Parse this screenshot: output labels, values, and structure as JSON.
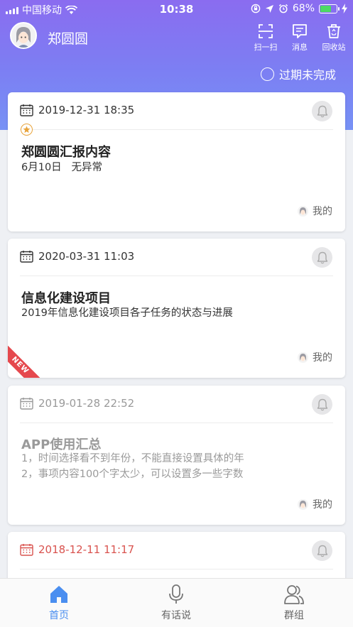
{
  "status_bar": {
    "carrier": "中国移动",
    "time": "10:38",
    "battery_percent": "68%",
    "battery_level": 0.68
  },
  "header": {
    "user_name": "郑圆圆",
    "actions": [
      {
        "label": "扫一扫",
        "icon": "scan-icon"
      },
      {
        "label": "消息",
        "icon": "message-icon"
      },
      {
        "label": "回收站",
        "icon": "recycle-bin-icon"
      }
    ],
    "filter_label": "过期未完成"
  },
  "cards": [
    {
      "datetime": "2019-12-31 18:35",
      "title": "郑圆圆汇报内容",
      "desc": [
        "6月10日   无异常"
      ],
      "owner": "我的",
      "starred": true,
      "state": "normal"
    },
    {
      "datetime": "2020-03-31 11:03",
      "title": "信息化建设项目",
      "desc": [
        "2019年信息化建设项目各子任务的状态与进展"
      ],
      "owner": "我的",
      "badge": "NEW",
      "state": "normal"
    },
    {
      "datetime": "2019-01-28 22:52",
      "title": "APP使用汇总",
      "desc": [
        "1，时间选择看不到年份，不能直接设置具体的年",
        "2，事项内容100个字太少，可以设置多一些字数"
      ],
      "owner": "我的",
      "state": "completed"
    },
    {
      "datetime": "2018-12-11 11:17",
      "state": "overdue"
    }
  ],
  "tabs": [
    {
      "label": "首页",
      "icon": "home-icon",
      "active": true
    },
    {
      "label": "有话说",
      "icon": "microphone-icon",
      "active": false
    },
    {
      "label": "群组",
      "icon": "group-icon",
      "active": false
    }
  ],
  "colors": {
    "header_gradient_top": "#8a6cf0",
    "header_gradient_bottom": "#7792f5",
    "active_tab": "#4a8ef0",
    "overdue": "#d9534f",
    "new_badge": "#e5484d",
    "star": "#e8a33a"
  }
}
